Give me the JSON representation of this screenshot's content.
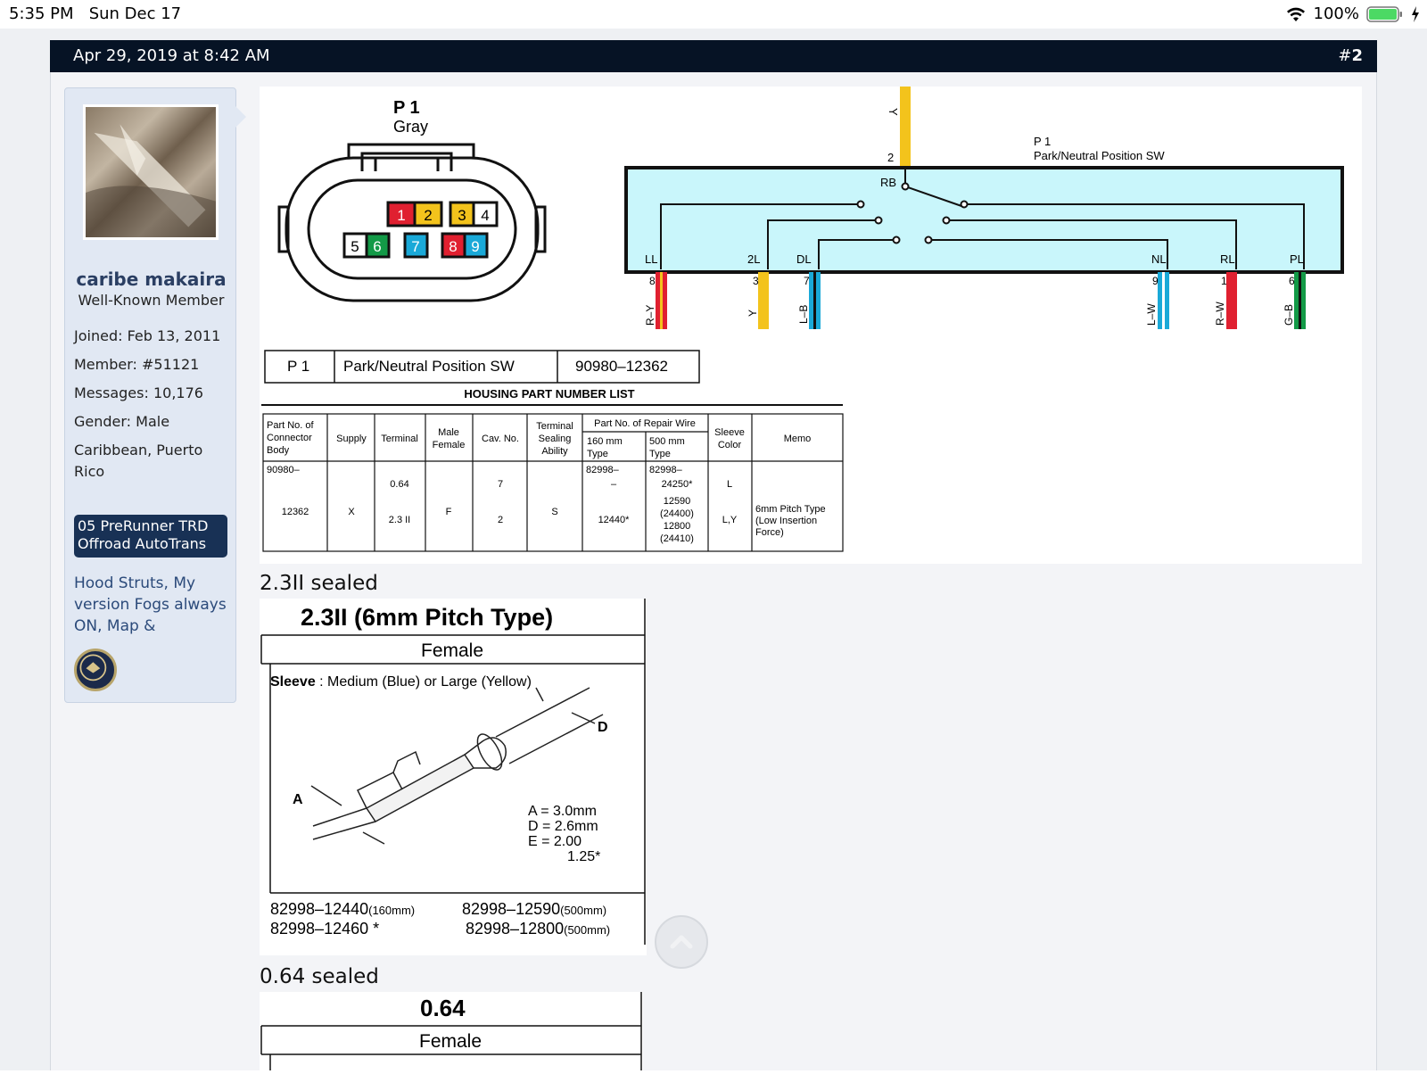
{
  "status_bar": {
    "time": "5:35 PM",
    "date": "Sun Dec 17",
    "battery": "100%"
  },
  "post": {
    "date": "Apr 29, 2019 at 8:42 AM",
    "number_prefix": "#",
    "number": "2"
  },
  "user": {
    "name": "caribe makaira",
    "title": "Well-Known Member",
    "joined_label": "Joined:",
    "joined": "Feb 13, 2011",
    "member_label": "Member:",
    "member": "#51121",
    "messages_label": "Messages:",
    "messages": "10,176",
    "gender_label": "Gender:",
    "gender": "Male",
    "location_line1": "Caribbean, Puerto",
    "location_line2": "Rico",
    "banner_line1": "05 PreRunner TRD",
    "banner_line2": "Offroad AutoTrans",
    "signature_line1": "Hood Struts, My",
    "signature_line2": "version Fogs always",
    "signature_line3": "ON, Map &"
  },
  "diagram": {
    "connector_name": "P 1",
    "connector_color": "Gray",
    "pins_row1": [
      "1",
      "2",
      "3",
      "4"
    ],
    "pins_row2": [
      "5",
      "6",
      "7",
      "8",
      "9"
    ],
    "switch_label1": "P 1",
    "switch_label2": "Park/Neutral Position SW",
    "top_wire_color": "Y",
    "top_wire_pin": "2",
    "rb_label": "RB",
    "positions": [
      "LL",
      "2L",
      "DL",
      "NL",
      "RL",
      "PL"
    ],
    "pin_numbers": [
      "8",
      "3",
      "7",
      "9",
      "1",
      "6"
    ],
    "wire_colors": [
      "R–Y",
      "Y",
      "L–B",
      "L–W",
      "R–W",
      "G–B"
    ],
    "part_row": {
      "code": "P 1",
      "name": "Park/Neutral Position SW",
      "number": "90980–12362"
    },
    "table_title": "HOUSING PART NUMBER LIST",
    "table_headers": {
      "part_no": [
        "Part No. of",
        "Connector",
        "Body"
      ],
      "supply": "Supply",
      "terminal": "Terminal",
      "male_female": [
        "Male",
        "Female"
      ],
      "cav": "Cav. No.",
      "sealing": [
        "Terminal",
        "Sealing",
        "Ability"
      ],
      "repair_wire": "Part No. of Repair Wire",
      "mm160": [
        "160 mm",
        "Type"
      ],
      "mm500": [
        "500 mm",
        "Type"
      ],
      "sleeve": [
        "Sleeve",
        "Color"
      ],
      "memo": "Memo"
    },
    "table_row": {
      "part_a": "90980–",
      "part_b": "12362",
      "supply": "X",
      "terminal_a": "0.64",
      "terminal_b": "2.3 II",
      "mf": "F",
      "cav_a": "7",
      "cav_b": "2",
      "sealing": "S",
      "w160_a": "82998–",
      "w160_b": "–",
      "w160_c": "12440*",
      "w500_a": "82998–",
      "w500_b": "24250*",
      "w500_c": "12590",
      "w500_d": "(24400)",
      "w500_e": "12800",
      "w500_f": "(24410)",
      "sleeve_a": "L",
      "sleeve_b": "L,Y",
      "memo_a": "6mm Pitch Type",
      "memo_b": "(Low Insertion",
      "memo_c": "Force)"
    }
  },
  "caption1": "2.3II sealed",
  "terminal1": {
    "title": "2.3II (6mm Pitch Type)",
    "subtitle": "Female",
    "sleeve_label": "Sleeve",
    "sleeve_text": " : Medium (Blue) or Large (Yellow)",
    "label_a": "A",
    "label_d": "D",
    "dim_a": "A = 3.0mm",
    "dim_d": "D = 2.6mm",
    "dim_e": "E = 2.00",
    "dim_e2": "1.25*",
    "pn1": "82998–12440",
    "pn1_unit": "(160mm)",
    "pn2": "82998–12590",
    "pn2_unit": "(500mm)",
    "pn3": "82998–12460 *",
    "pn4": "82998–12800",
    "pn4_unit": "(500mm)"
  },
  "caption2": "0.64 sealed",
  "terminal2": {
    "title": "0.64",
    "subtitle": "Female"
  },
  "colors": {
    "header": "#061325",
    "panel": "#e1e8f3",
    "banner": "#183155",
    "switch_fill": "#c9f6fb"
  }
}
